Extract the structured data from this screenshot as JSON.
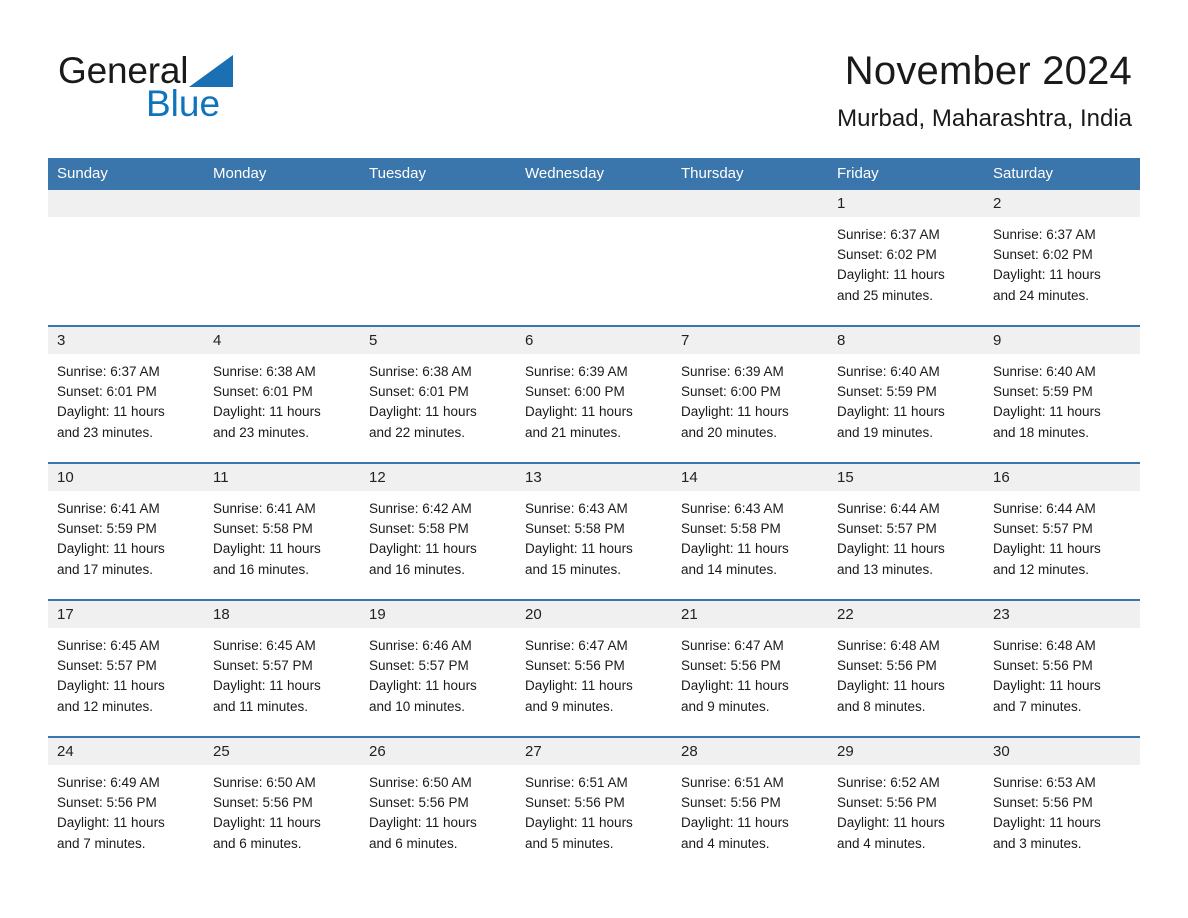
{
  "brand": {
    "name_part1": "General",
    "name_part2": "Blue",
    "triangle_color": "#1b6fb3"
  },
  "header": {
    "title": "November 2024",
    "subtitle": "Murbad, Maharashtra, India"
  },
  "theme": {
    "header_blue": "#3a76ab",
    "daynum_gray": "#f0f0f0",
    "text_dark": "#1a1a1a",
    "brand_blue": "#0f74bd"
  },
  "weekday_headers": [
    "Sunday",
    "Monday",
    "Tuesday",
    "Wednesday",
    "Thursday",
    "Friday",
    "Saturday"
  ],
  "weeks": [
    [
      {
        "day": "",
        "lines": []
      },
      {
        "day": "",
        "lines": []
      },
      {
        "day": "",
        "lines": []
      },
      {
        "day": "",
        "lines": []
      },
      {
        "day": "",
        "lines": []
      },
      {
        "day": "1",
        "lines": [
          "Sunrise: 6:37 AM",
          "Sunset: 6:02 PM",
          "Daylight: 11 hours",
          "and 25 minutes."
        ]
      },
      {
        "day": "2",
        "lines": [
          "Sunrise: 6:37 AM",
          "Sunset: 6:02 PM",
          "Daylight: 11 hours",
          "and 24 minutes."
        ]
      }
    ],
    [
      {
        "day": "3",
        "lines": [
          "Sunrise: 6:37 AM",
          "Sunset: 6:01 PM",
          "Daylight: 11 hours",
          "and 23 minutes."
        ]
      },
      {
        "day": "4",
        "lines": [
          "Sunrise: 6:38 AM",
          "Sunset: 6:01 PM",
          "Daylight: 11 hours",
          "and 23 minutes."
        ]
      },
      {
        "day": "5",
        "lines": [
          "Sunrise: 6:38 AM",
          "Sunset: 6:01 PM",
          "Daylight: 11 hours",
          "and 22 minutes."
        ]
      },
      {
        "day": "6",
        "lines": [
          "Sunrise: 6:39 AM",
          "Sunset: 6:00 PM",
          "Daylight: 11 hours",
          "and 21 minutes."
        ]
      },
      {
        "day": "7",
        "lines": [
          "Sunrise: 6:39 AM",
          "Sunset: 6:00 PM",
          "Daylight: 11 hours",
          "and 20 minutes."
        ]
      },
      {
        "day": "8",
        "lines": [
          "Sunrise: 6:40 AM",
          "Sunset: 5:59 PM",
          "Daylight: 11 hours",
          "and 19 minutes."
        ]
      },
      {
        "day": "9",
        "lines": [
          "Sunrise: 6:40 AM",
          "Sunset: 5:59 PM",
          "Daylight: 11 hours",
          "and 18 minutes."
        ]
      }
    ],
    [
      {
        "day": "10",
        "lines": [
          "Sunrise: 6:41 AM",
          "Sunset: 5:59 PM",
          "Daylight: 11 hours",
          "and 17 minutes."
        ]
      },
      {
        "day": "11",
        "lines": [
          "Sunrise: 6:41 AM",
          "Sunset: 5:58 PM",
          "Daylight: 11 hours",
          "and 16 minutes."
        ]
      },
      {
        "day": "12",
        "lines": [
          "Sunrise: 6:42 AM",
          "Sunset: 5:58 PM",
          "Daylight: 11 hours",
          "and 16 minutes."
        ]
      },
      {
        "day": "13",
        "lines": [
          "Sunrise: 6:43 AM",
          "Sunset: 5:58 PM",
          "Daylight: 11 hours",
          "and 15 minutes."
        ]
      },
      {
        "day": "14",
        "lines": [
          "Sunrise: 6:43 AM",
          "Sunset: 5:58 PM",
          "Daylight: 11 hours",
          "and 14 minutes."
        ]
      },
      {
        "day": "15",
        "lines": [
          "Sunrise: 6:44 AM",
          "Sunset: 5:57 PM",
          "Daylight: 11 hours",
          "and 13 minutes."
        ]
      },
      {
        "day": "16",
        "lines": [
          "Sunrise: 6:44 AM",
          "Sunset: 5:57 PM",
          "Daylight: 11 hours",
          "and 12 minutes."
        ]
      }
    ],
    [
      {
        "day": "17",
        "lines": [
          "Sunrise: 6:45 AM",
          "Sunset: 5:57 PM",
          "Daylight: 11 hours",
          "and 12 minutes."
        ]
      },
      {
        "day": "18",
        "lines": [
          "Sunrise: 6:45 AM",
          "Sunset: 5:57 PM",
          "Daylight: 11 hours",
          "and 11 minutes."
        ]
      },
      {
        "day": "19",
        "lines": [
          "Sunrise: 6:46 AM",
          "Sunset: 5:57 PM",
          "Daylight: 11 hours",
          "and 10 minutes."
        ]
      },
      {
        "day": "20",
        "lines": [
          "Sunrise: 6:47 AM",
          "Sunset: 5:56 PM",
          "Daylight: 11 hours",
          "and 9 minutes."
        ]
      },
      {
        "day": "21",
        "lines": [
          "Sunrise: 6:47 AM",
          "Sunset: 5:56 PM",
          "Daylight: 11 hours",
          "and 9 minutes."
        ]
      },
      {
        "day": "22",
        "lines": [
          "Sunrise: 6:48 AM",
          "Sunset: 5:56 PM",
          "Daylight: 11 hours",
          "and 8 minutes."
        ]
      },
      {
        "day": "23",
        "lines": [
          "Sunrise: 6:48 AM",
          "Sunset: 5:56 PM",
          "Daylight: 11 hours",
          "and 7 minutes."
        ]
      }
    ],
    [
      {
        "day": "24",
        "lines": [
          "Sunrise: 6:49 AM",
          "Sunset: 5:56 PM",
          "Daylight: 11 hours",
          "and 7 minutes."
        ]
      },
      {
        "day": "25",
        "lines": [
          "Sunrise: 6:50 AM",
          "Sunset: 5:56 PM",
          "Daylight: 11 hours",
          "and 6 minutes."
        ]
      },
      {
        "day": "26",
        "lines": [
          "Sunrise: 6:50 AM",
          "Sunset: 5:56 PM",
          "Daylight: 11 hours",
          "and 6 minutes."
        ]
      },
      {
        "day": "27",
        "lines": [
          "Sunrise: 6:51 AM",
          "Sunset: 5:56 PM",
          "Daylight: 11 hours",
          "and 5 minutes."
        ]
      },
      {
        "day": "28",
        "lines": [
          "Sunrise: 6:51 AM",
          "Sunset: 5:56 PM",
          "Daylight: 11 hours",
          "and 4 minutes."
        ]
      },
      {
        "day": "29",
        "lines": [
          "Sunrise: 6:52 AM",
          "Sunset: 5:56 PM",
          "Daylight: 11 hours",
          "and 4 minutes."
        ]
      },
      {
        "day": "30",
        "lines": [
          "Sunrise: 6:53 AM",
          "Sunset: 5:56 PM",
          "Daylight: 11 hours",
          "and 3 minutes."
        ]
      }
    ]
  ]
}
